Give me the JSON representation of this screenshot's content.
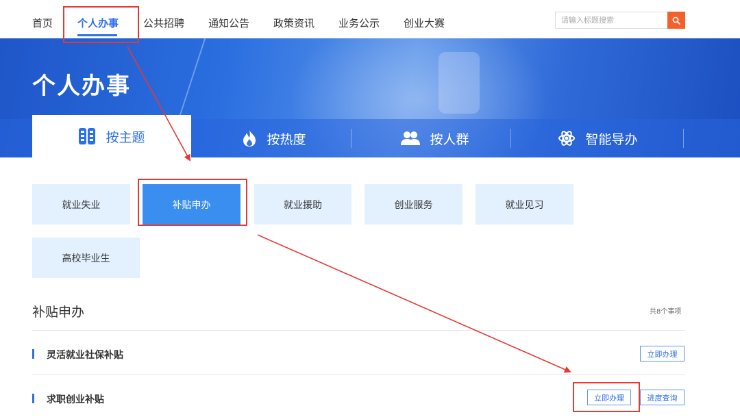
{
  "nav": {
    "items": [
      "首页",
      "个人办事",
      "公共招聘",
      "通知公告",
      "政策资讯",
      "业务公示",
      "创业大赛"
    ],
    "active_index": 1,
    "search_placeholder": "请输入标题搜索",
    "search_icon": "search-icon"
  },
  "banner": {
    "title": "个人办事",
    "tabs": [
      {
        "label": "按主题",
        "icon": "grid-icon"
      },
      {
        "label": "按热度",
        "icon": "flame-icon"
      },
      {
        "label": "按人群",
        "icon": "people-icon"
      },
      {
        "label": "智能导办",
        "icon": "atom-icon"
      }
    ],
    "active_tab": 0
  },
  "categories": [
    "就业失业",
    "补贴申办",
    "就业援助",
    "创业服务",
    "就业见习",
    "高校毕业生"
  ],
  "active_category": 1,
  "section": {
    "title": "补贴申办",
    "count": "共8个事项",
    "items": [
      {
        "label": "灵活就业社保补贴",
        "apply": "立即办理"
      },
      {
        "label": "求职创业补贴",
        "apply": "立即办理",
        "progress": "进度查询"
      }
    ]
  },
  "colors": {
    "accent": "#2d6fe6",
    "search_button": "#f2612b",
    "category_bg": "#e3f0fd",
    "category_active": "#3a8ef0",
    "annotation": "#e53935"
  }
}
